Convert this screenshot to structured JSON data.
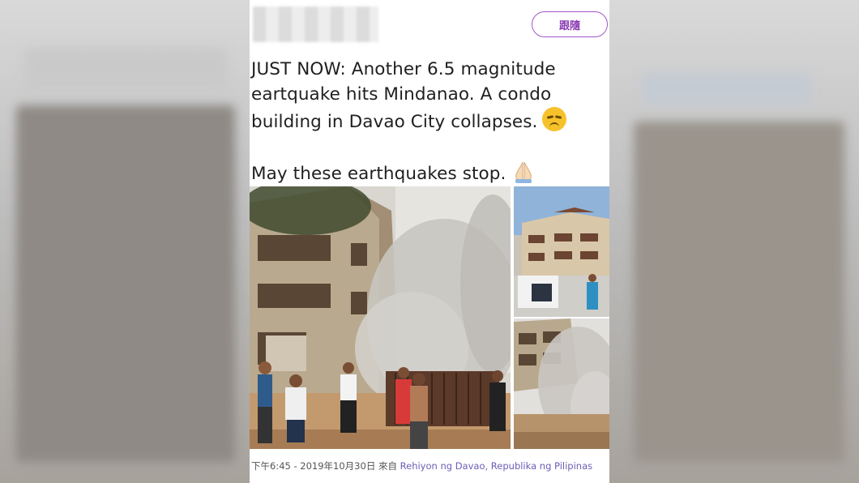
{
  "tweet": {
    "follow_label": "跟隨",
    "text_line1": "JUST NOW: Another 6.5 magnitude",
    "text_line2": "eartquake hits Mindanao. A condo",
    "text_line3": "building in Davao City collapses.",
    "text_line4": "May these earthquakes stop.",
    "emoji_1": "disappointed-face-icon",
    "emoji_2": "folded-hands-icon",
    "timestamp": "下午6:45 - 2019年10月30日 來自",
    "location": "Rehiyon ng Davao, Republika ng Pilipinas"
  },
  "photos": [
    {
      "name": "building-collapse-photo-main",
      "subject": "building collapsing with dust cloud, people on street"
    },
    {
      "name": "building-photo-top-right",
      "subject": "apartment building under blue sky"
    },
    {
      "name": "building-photo-bottom-right",
      "subject": "building collapsing, dust cloud"
    }
  ],
  "colors": {
    "follow_accent": "#a256c9",
    "location_link": "#6b5fb5",
    "text": "#1f1f1f"
  }
}
